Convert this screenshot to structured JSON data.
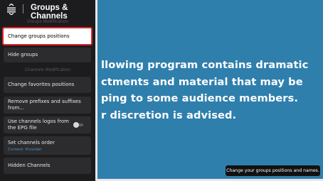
{
  "header": {
    "title": "Groups & Channels"
  },
  "sections": {
    "groups": "Groups Modification",
    "channels": "Channels Modification"
  },
  "items": [
    {
      "label": "Change groups positions"
    },
    {
      "label": "Hide groups"
    },
    {
      "label": "Change favorites positions"
    },
    {
      "label": "Remove prefixes and suffixes from..."
    },
    {
      "label": "Use channels logos from the EPG file",
      "toggle": false
    },
    {
      "label": "Set channels order",
      "sub": "Current: Provider"
    },
    {
      "label": "Hidden Channels"
    }
  ],
  "video": {
    "warning": "llowing program contains dramatic\nctments and material that may be\nping to some audience members.\nr discretion is advised."
  },
  "tooltip": "Change your groups positions and names.",
  "colors": {
    "sidebar_bg": "#1c1c1e",
    "item_bg": "#2c2c2e",
    "focus_border": "#e3242b",
    "video_bg": "#2f7fad",
    "sub_text": "#4f8ec9"
  },
  "icons": [
    "menu-icon",
    "toggle-switch"
  ]
}
